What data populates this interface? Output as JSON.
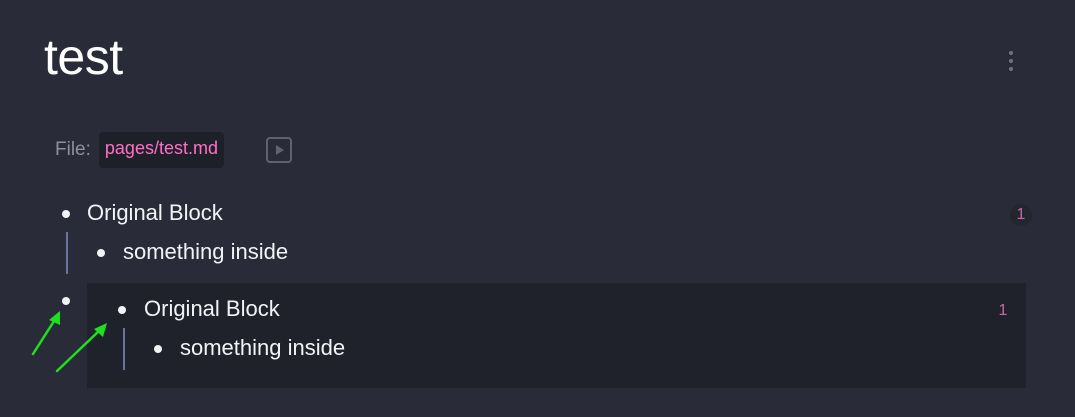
{
  "page": {
    "title": "test"
  },
  "file": {
    "label": "File:",
    "path": "pages/test.md"
  },
  "blocks": [
    {
      "text": "Original Block",
      "ref_count": "1",
      "children": [
        {
          "text": "something inside"
        }
      ]
    }
  ],
  "embedded_block": {
    "text": "Original Block",
    "ref_count": "1",
    "children": [
      {
        "text": "something inside"
      }
    ]
  },
  "icons": {
    "more": "more-vertical-icon",
    "play": "play-square-icon",
    "annotation_arrow": "green-arrow"
  },
  "colors": {
    "background": "#292b38",
    "embed_background": "#20222b",
    "file_path": "#ff6fc6",
    "ref_count": "#c66aa8",
    "guide_line": "#6c73a3",
    "annotation_arrow": "#1ee01e"
  }
}
